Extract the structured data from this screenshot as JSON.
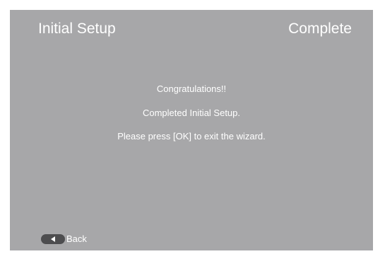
{
  "header": {
    "title": "Initial Setup",
    "status": "Complete"
  },
  "body": {
    "line1": "Congratulations!!",
    "line2": "Completed Initial Setup.",
    "line3": "Please press [OK] to exit the wizard."
  },
  "footer": {
    "back_icon": "left-arrow-key-icon",
    "back_label": "Back"
  },
  "colors": {
    "background": "#a7a7a9",
    "text": "#ffffff",
    "key": "#4d4d4f"
  }
}
